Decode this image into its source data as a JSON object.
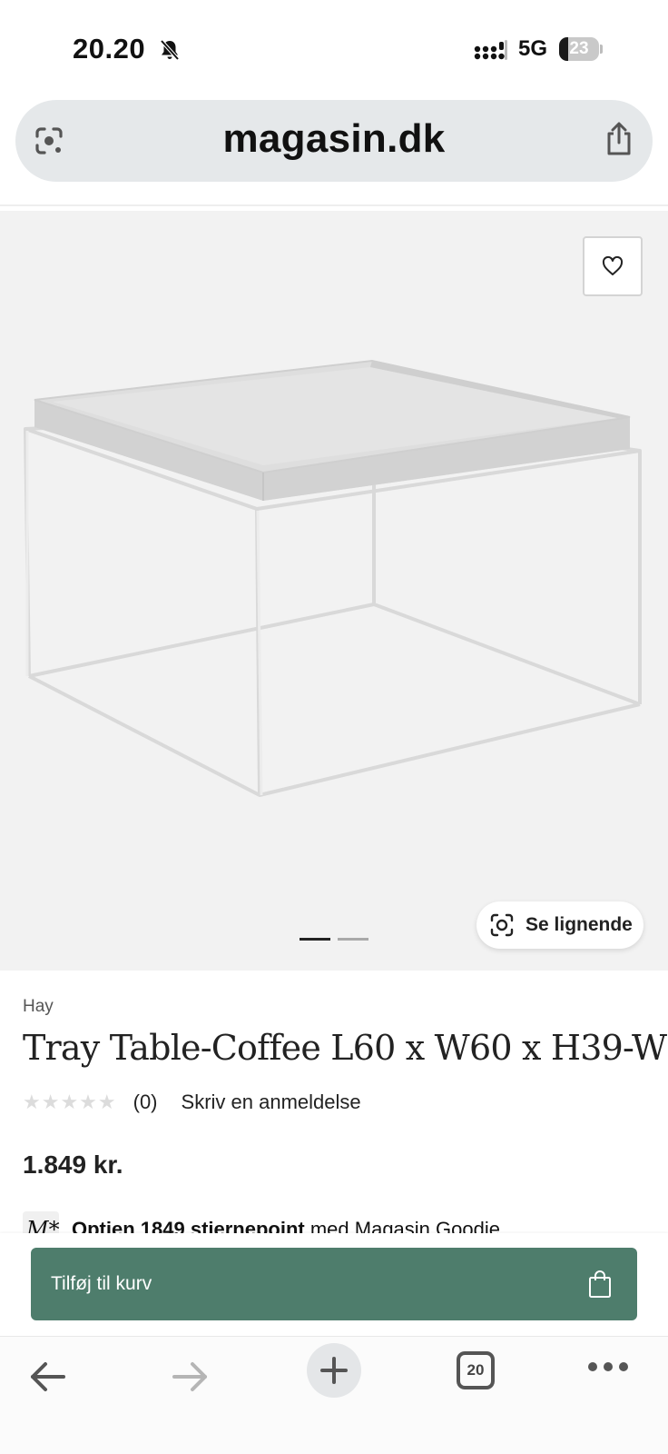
{
  "status_bar": {
    "time": "20.20",
    "network": "5G",
    "battery_level": "23",
    "battery_fraction": 0.23
  },
  "browser": {
    "url": "magasin.dk",
    "open_tabs": "20"
  },
  "product": {
    "brand": "Hay",
    "title": "Tray Table-Coffee L60 x W60 x H39-W",
    "rating_stars": "★★★★★",
    "review_count": "(0)",
    "write_review_label": "Skriv en anmeldelse",
    "price": "1.849 kr.",
    "similar_label": "Se lignende",
    "image_count": 2,
    "active_image": 1,
    "points_logo": "M*",
    "points_bold": "Optjen 1849 stjernepoint",
    "points_rest": " med Magasin Goodie"
  },
  "cart": {
    "add_label": "Tilføj til kurv",
    "button_color": "#4e7d6c"
  },
  "icons": {
    "bell": "bell-slash-icon",
    "lens": "google-lens-icon",
    "share": "share-icon",
    "favorite": "heart-icon",
    "bag": "shopping-bag-icon"
  }
}
